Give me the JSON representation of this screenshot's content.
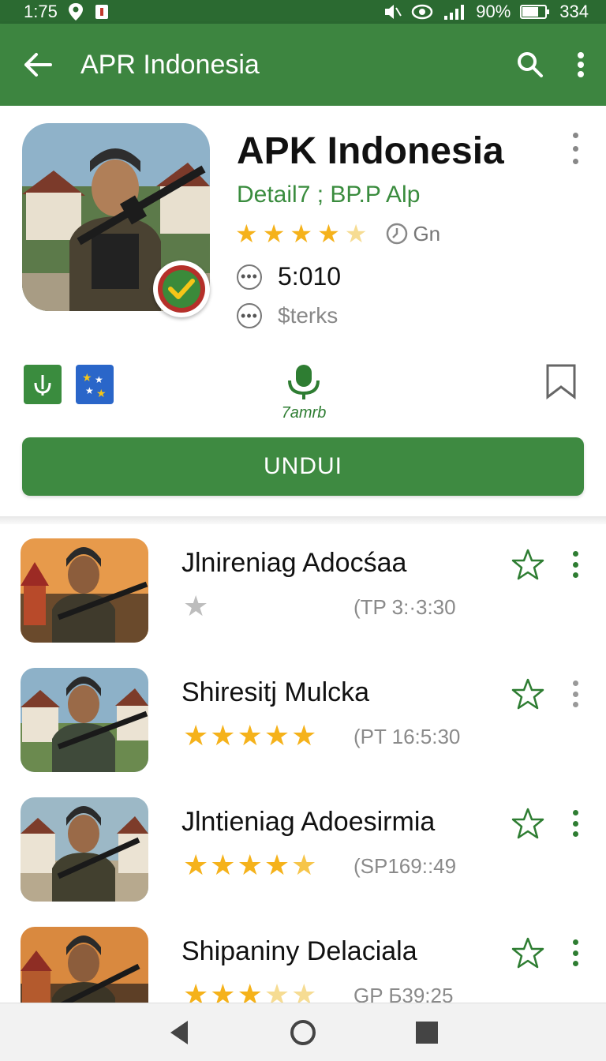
{
  "status_bar": {
    "time": "1:75",
    "battery_percent": "90%",
    "extra": "334"
  },
  "app_bar": {
    "title": "APR Indonesia"
  },
  "hero": {
    "app_name": "APK Indonesia",
    "subtitle": "Detail7 ; BP.P Alp",
    "rating_value": 4.5,
    "rating_extra": "Gn",
    "meta1": "5:010",
    "meta2": "$terks",
    "mic_label": "7amrb",
    "download_label": "UNDUI"
  },
  "list": [
    {
      "name": "Jlnireniag Adocśaa",
      "rating": 1,
      "stamp": "(TP 3:·3:30"
    },
    {
      "name": "Shiresitj Mulcka",
      "rating": 5,
      "stamp": "(PT 16:5:30"
    },
    {
      "name": "Jlntieniag Adoesirmia",
      "rating": 5,
      "stamp": "(SP169::49"
    },
    {
      "name": "Shipaniny Delaciala",
      "rating": 3.5,
      "stamp": "GP Б39:25"
    }
  ],
  "colors": {
    "primary": "#3d8540",
    "status": "#2b6a31",
    "star": "#f5b21b",
    "accent_green": "#3a8c3e"
  }
}
